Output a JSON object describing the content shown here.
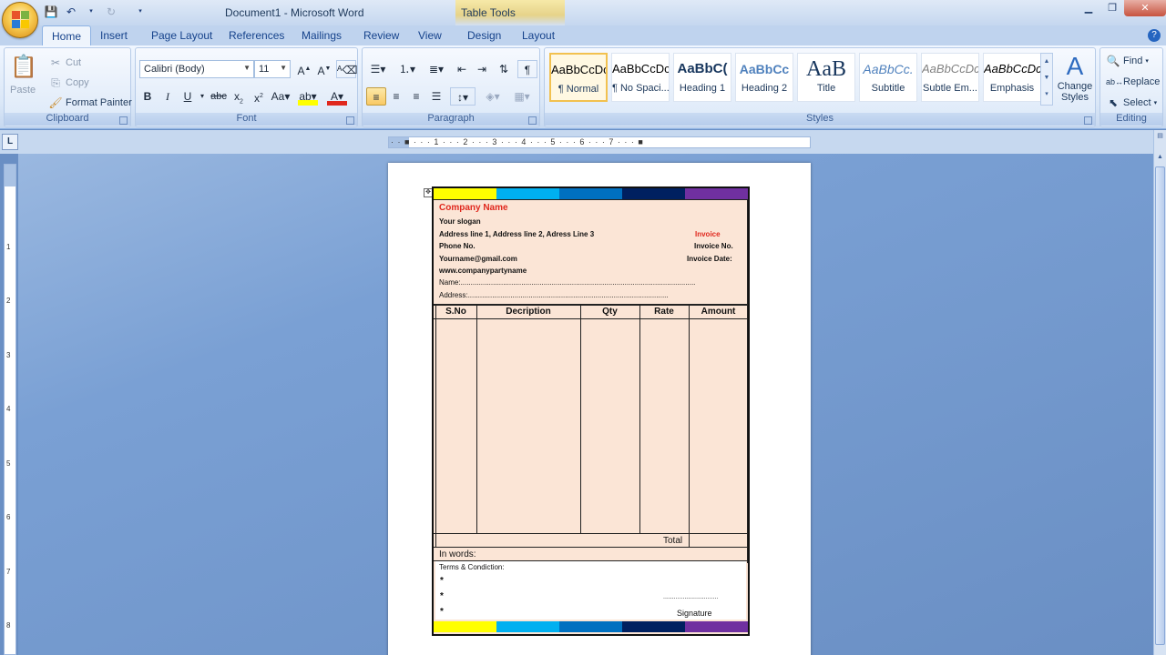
{
  "app": {
    "title": "Document1 - Microsoft Word",
    "contextual_tab_group": "Table Tools"
  },
  "tabs": [
    {
      "label": "Home",
      "active": true
    },
    {
      "label": "Insert"
    },
    {
      "label": "Page Layout"
    },
    {
      "label": "References"
    },
    {
      "label": "Mailings"
    },
    {
      "label": "Review"
    },
    {
      "label": "View"
    },
    {
      "label": "Design"
    },
    {
      "label": "Layout"
    }
  ],
  "clipboard": {
    "label": "Clipboard",
    "paste": "Paste",
    "cut": "Cut",
    "copy": "Copy",
    "format_painter": "Format Painter"
  },
  "font": {
    "label": "Font",
    "family": "Calibri (Body)",
    "size": "11"
  },
  "paragraph": {
    "label": "Paragraph"
  },
  "styles": {
    "label": "Styles",
    "items": [
      {
        "preview": "AaBbCcDc",
        "name": "¶ Normal",
        "selected": true
      },
      {
        "preview": "AaBbCcDc",
        "name": "¶ No Spaci..."
      },
      {
        "preview": "AaBbC(",
        "name": "Heading 1"
      },
      {
        "preview": "AaBbCc",
        "name": "Heading 2"
      },
      {
        "preview": "AaB",
        "name": "Title"
      },
      {
        "preview": "AaBbCc.",
        "name": "Subtitle"
      },
      {
        "preview": "AaBbCcDc",
        "name": "Subtle Em..."
      },
      {
        "preview": "AaBbCcDc",
        "name": "Emphasis"
      }
    ],
    "change_styles": "Change Styles"
  },
  "editing": {
    "label": "Editing",
    "find": "Find",
    "replace": "Replace",
    "select": "Select"
  },
  "ruler": {
    "horizontal": "· · ■ · · · 1 · · · 2 · · · 3 · · · 4 · · · 5 · · · 6 · · · 7 · · · ■",
    "vertical_numbers": [
      "1",
      "2",
      "3",
      "4",
      "5",
      "6",
      "7",
      "8"
    ]
  },
  "colors": {
    "bar": [
      "#ffff00",
      "#00b0f0",
      "#0070c0",
      "#002060",
      "#7030a0"
    ],
    "invoice_fill": "#fbe5d6",
    "company_name": "#e0281e"
  },
  "invoice": {
    "company_name": "Company Name",
    "slogan": "Your slogan",
    "address": "Address line 1, Address line 2, Adress Line 3",
    "phone": "Phone No.",
    "email": "Yourname@gmail.com",
    "website": "www.companypartyname",
    "name_line": "Name:....................................................................................................................",
    "address_line": "Address:...................................................................................................",
    "invoice_title": "Invoice",
    "invoice_no": "Invoice No.",
    "invoice_date": "Invoice Date:",
    "columns": [
      "S.No",
      "Decription",
      "Qty",
      "Rate",
      "Amount"
    ],
    "total": "Total",
    "in_words": "In words:",
    "terms": "Terms & Condiction:",
    "bullets": [
      "*",
      "*",
      "*"
    ],
    "signature_line": "...............................",
    "signature": "Signature"
  }
}
